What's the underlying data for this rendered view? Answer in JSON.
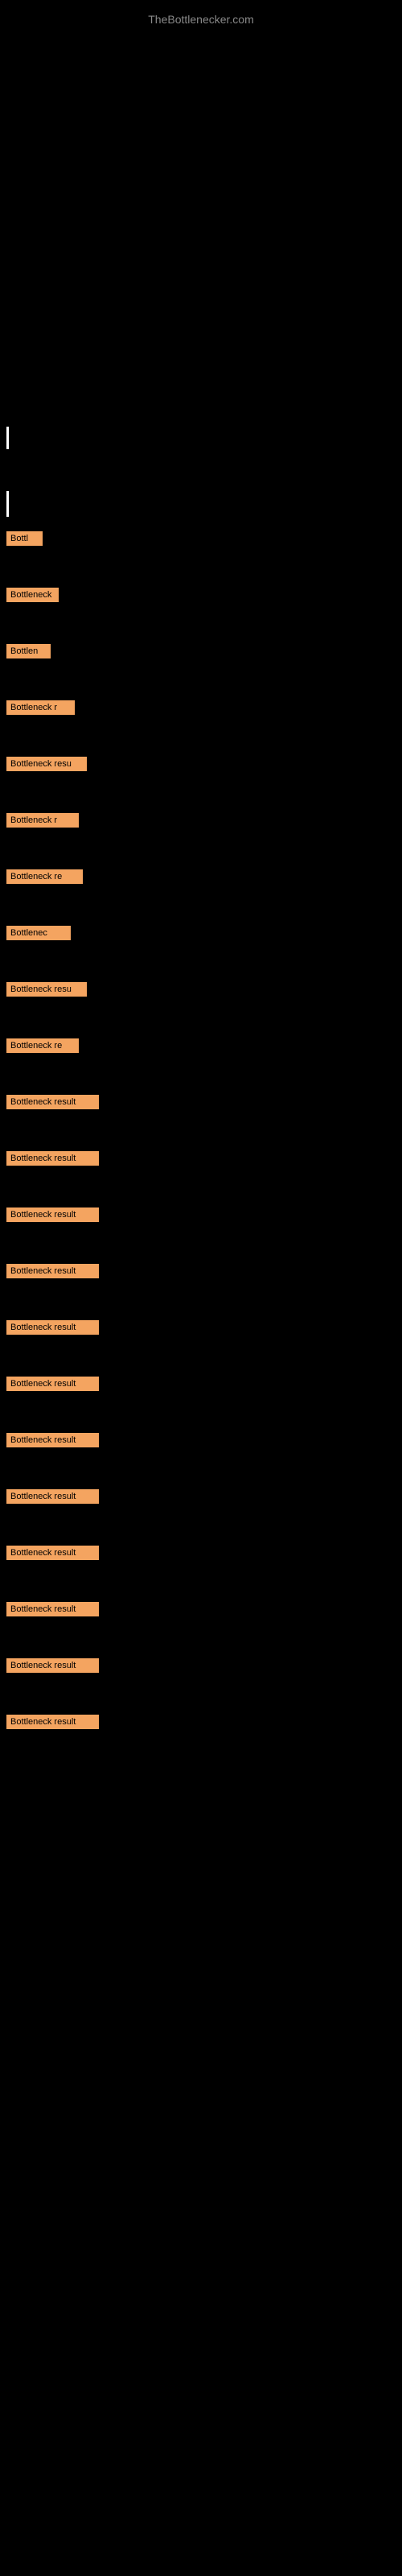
{
  "site": {
    "title": "TheBottlenecker.com"
  },
  "bottleneck_items": [
    {
      "id": 1,
      "label": "Bottl",
      "width_class": "item-1"
    },
    {
      "id": 2,
      "label": "Bottleneck",
      "width_class": "item-2"
    },
    {
      "id": 3,
      "label": "Bottlen",
      "width_class": "item-3"
    },
    {
      "id": 4,
      "label": "Bottleneck r",
      "width_class": "item-4"
    },
    {
      "id": 5,
      "label": "Bottleneck resu",
      "width_class": "item-5"
    },
    {
      "id": 6,
      "label": "Bottleneck r",
      "width_class": "item-6"
    },
    {
      "id": 7,
      "label": "Bottleneck re",
      "width_class": "item-7"
    },
    {
      "id": 8,
      "label": "Bottlenec",
      "width_class": "item-8"
    },
    {
      "id": 9,
      "label": "Bottleneck resu",
      "width_class": "item-9"
    },
    {
      "id": 10,
      "label": "Bottleneck re",
      "width_class": "item-10"
    },
    {
      "id": 11,
      "label": "Bottleneck result",
      "width_class": "item-11"
    },
    {
      "id": 12,
      "label": "Bottleneck result",
      "width_class": "item-12"
    },
    {
      "id": 13,
      "label": "Bottleneck result",
      "width_class": "item-13"
    },
    {
      "id": 14,
      "label": "Bottleneck result",
      "width_class": "item-14"
    },
    {
      "id": 15,
      "label": "Bottleneck result",
      "width_class": "item-15"
    },
    {
      "id": 16,
      "label": "Bottleneck result",
      "width_class": "item-16"
    },
    {
      "id": 17,
      "label": "Bottleneck result",
      "width_class": "item-17"
    },
    {
      "id": 18,
      "label": "Bottleneck result",
      "width_class": "item-18"
    },
    {
      "id": 19,
      "label": "Bottleneck result",
      "width_class": "item-19"
    },
    {
      "id": 20,
      "label": "Bottleneck result",
      "width_class": "item-20"
    },
    {
      "id": 21,
      "label": "Bottleneck result",
      "width_class": "item-21"
    },
    {
      "id": 22,
      "label": "Bottleneck result",
      "width_class": "item-22"
    }
  ]
}
